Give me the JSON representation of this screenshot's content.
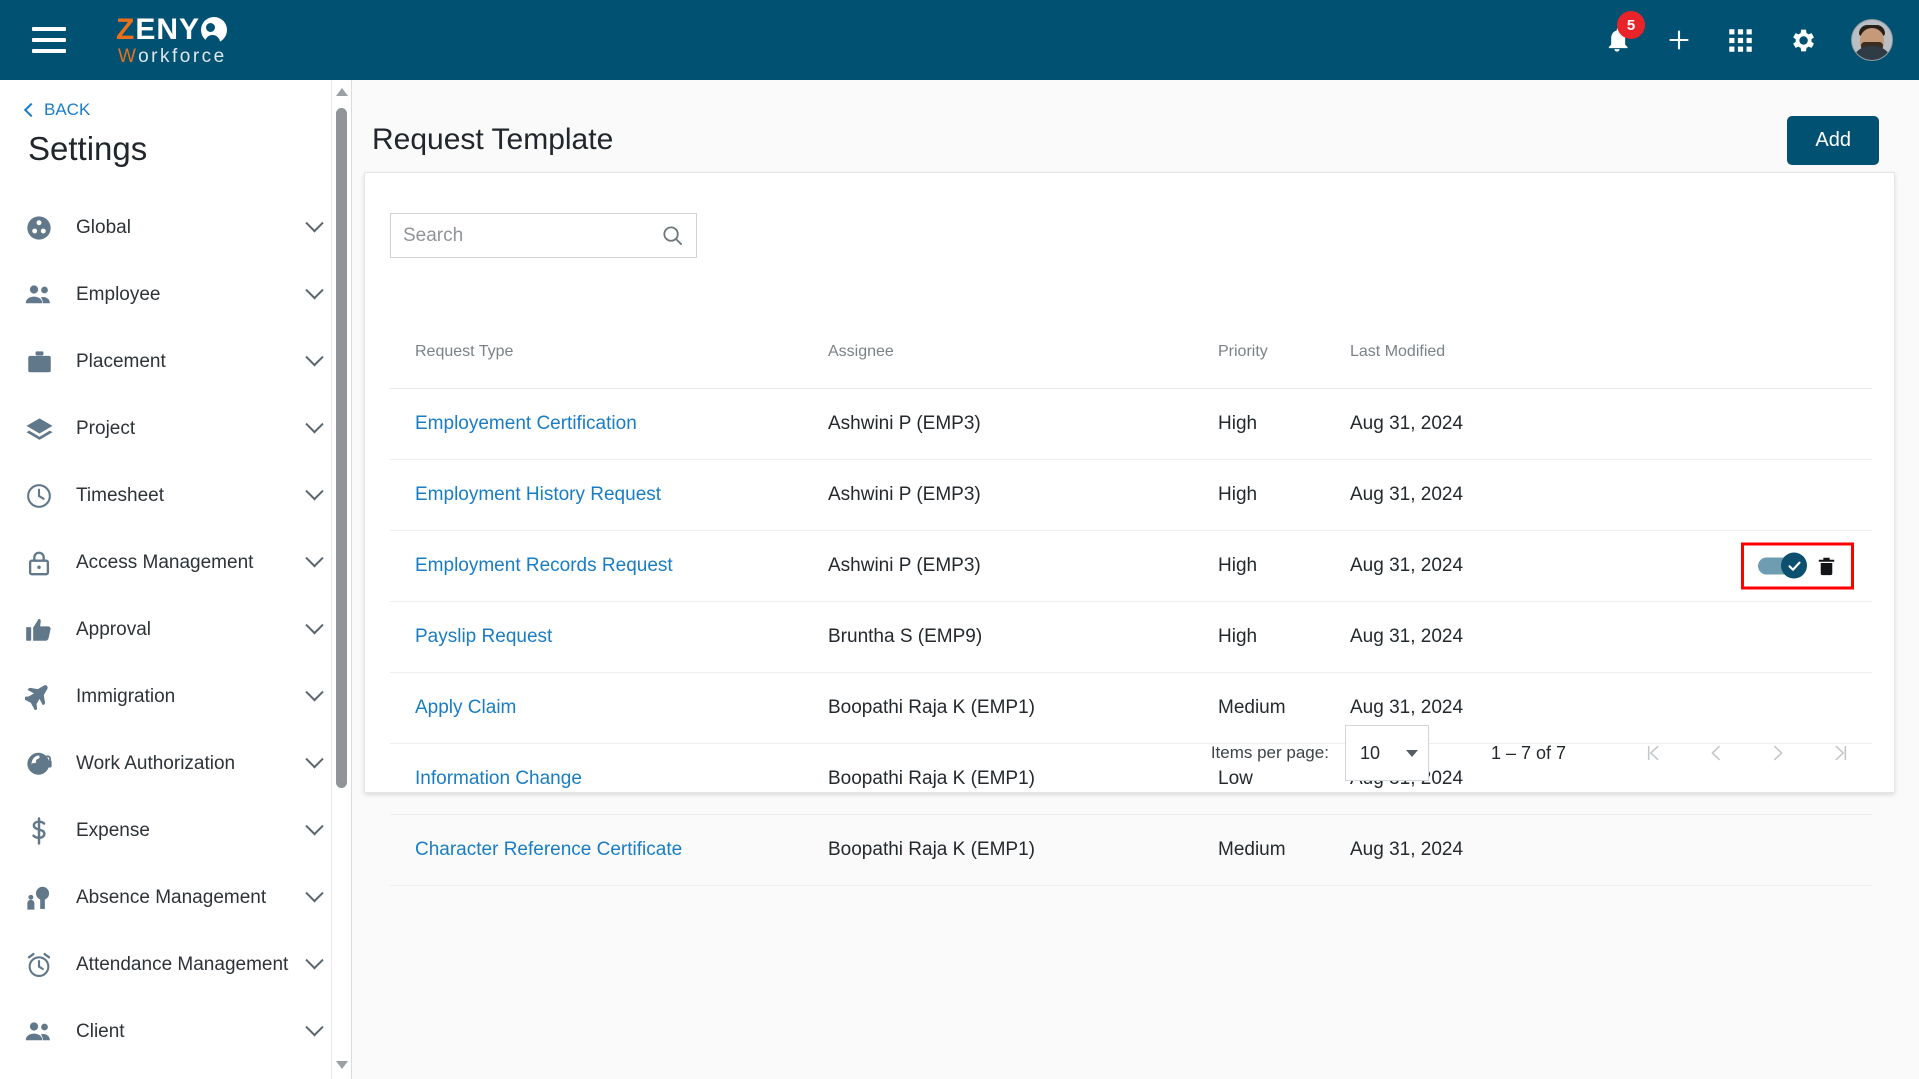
{
  "topbar": {
    "logo": {
      "part1": "Z",
      "part2": "ENY",
      "part3": "W",
      "part4": "orkforce"
    },
    "menu_icon": "hamburger-icon",
    "notifications_count": "5",
    "icons": [
      "bell-icon",
      "plus-icon",
      "apps-grid-icon",
      "gear-icon",
      "avatar"
    ]
  },
  "sidebar": {
    "back_label": "BACK",
    "title": "Settings",
    "items": [
      {
        "label": "Global",
        "icon": "global-icon"
      },
      {
        "label": "Employee",
        "icon": "people-icon"
      },
      {
        "label": "Placement",
        "icon": "briefcase-icon"
      },
      {
        "label": "Project",
        "icon": "layers-icon"
      },
      {
        "label": "Timesheet",
        "icon": "clock-icon"
      },
      {
        "label": "Access Management",
        "icon": "lock-icon"
      },
      {
        "label": "Approval",
        "icon": "thumbs-up-icon"
      },
      {
        "label": "Immigration",
        "icon": "airplane-icon"
      },
      {
        "label": "Work Authorization",
        "icon": "globe-lock-icon"
      },
      {
        "label": "Expense",
        "icon": "dollar-icon"
      },
      {
        "label": "Absence Management",
        "icon": "person-tree-icon"
      },
      {
        "label": "Attendance Management",
        "icon": "alarm-clock-icon"
      },
      {
        "label": "Client",
        "icon": "people-icon"
      }
    ]
  },
  "main": {
    "page_title": "Request Template",
    "add_label": "Add",
    "search": {
      "placeholder": "Search",
      "value": ""
    },
    "table": {
      "headers": [
        "Request Type",
        "Assignee",
        "Priority",
        "Last Modified"
      ],
      "rows": [
        {
          "type": "Employement Certification",
          "assignee": "Ashwini P (EMP3)",
          "priority": "High",
          "modified": "Aug 31, 2024",
          "highlighted": false
        },
        {
          "type": "Employment History Request",
          "assignee": "Ashwini P (EMP3)",
          "priority": "High",
          "modified": "Aug 31, 2024",
          "highlighted": false
        },
        {
          "type": "Employment Records Request",
          "assignee": "Ashwini P (EMP3)",
          "priority": "High",
          "modified": "Aug 31, 2024",
          "highlighted": true
        },
        {
          "type": "Payslip Request",
          "assignee": "Bruntha S (EMP9)",
          "priority": "High",
          "modified": "Aug 31, 2024",
          "highlighted": false
        },
        {
          "type": "Apply Claim",
          "assignee": "Boopathi Raja K (EMP1)",
          "priority": "Medium",
          "modified": "Aug 31, 2024",
          "highlighted": false
        },
        {
          "type": "Information Change",
          "assignee": "Boopathi Raja K (EMP1)",
          "priority": "Low",
          "modified": "Aug 31, 2024",
          "highlighted": false
        },
        {
          "type": "Character Reference Certificate",
          "assignee": "Boopathi Raja K (EMP1)",
          "priority": "Medium",
          "modified": "Aug 31, 2024",
          "highlighted": false
        }
      ]
    },
    "paginator": {
      "items_per_page_label": "Items per page:",
      "items_per_page_value": "10",
      "range_label": "1 – 7 of 7",
      "buttons": [
        "first-page-icon",
        "previous-page-icon",
        "next-page-icon",
        "last-page-icon"
      ]
    }
  },
  "colors": {
    "brand_dark": "#015172",
    "brand_orange": "#e8701a",
    "link_blue": "#1a7dc4",
    "badge_red": "#e8242a",
    "highlight_red": "#ff0000",
    "toggle_on": "#0c4f6e"
  }
}
